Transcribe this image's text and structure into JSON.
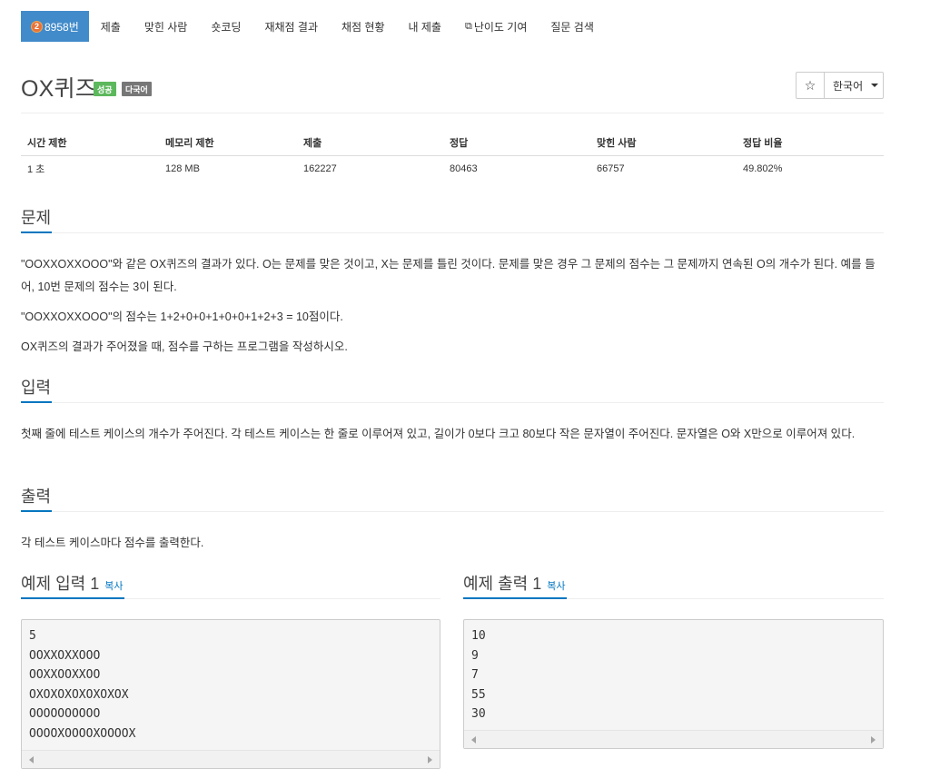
{
  "nav": {
    "problem_badge": "2",
    "problem_number": "8958번",
    "items": [
      "제출",
      "맞힌 사람",
      "숏코딩",
      "재채점 결과",
      "채점 현황",
      "내 제출",
      "난이도 기여",
      "질문 검색"
    ]
  },
  "problem": {
    "title": "OX퀴즈",
    "labels": [
      "성공",
      "다국어"
    ],
    "star_icon": "star-icon",
    "language": "한국어"
  },
  "info_table": {
    "headers": [
      "시간 제한",
      "메모리 제한",
      "제출",
      "정답",
      "맞힌 사람",
      "정답 비율"
    ],
    "values": [
      "1 초",
      "128 MB",
      "162227",
      "80463",
      "66757",
      "49.802%"
    ]
  },
  "sections": {
    "problem_title": "문제",
    "problem_text": [
      "\"OOXXOXXOOO\"와 같은 OX퀴즈의 결과가 있다. O는 문제를 맞은 것이고, X는 문제를 틀린 것이다. 문제를 맞은 경우 그 문제의 점수는 그 문제까지 연속된 O의 개수가 된다. 예를 들어, 10번 문제의 점수는 3이 된다.",
      "\"OOXXOXXOOO\"의 점수는 1+2+0+0+1+0+0+1+2+3 = 10점이다.",
      "OX퀴즈의 결과가 주어졌을 때, 점수를 구하는 프로그램을 작성하시오."
    ],
    "input_title": "입력",
    "input_text": "첫째 줄에 테스트 케이스의 개수가 주어진다. 각 테스트 케이스는 한 줄로 이루어져 있고, 길이가 0보다 크고 80보다 작은 문자열이 주어진다. 문자열은 O와 X만으로 이루어져 있다.",
    "output_title": "출력",
    "output_text": "각 테스트 케이스마다 점수를 출력한다."
  },
  "samples": {
    "input_title": "예제 입력 1",
    "output_title": "예제 출력 1",
    "copy_label": "복사",
    "input": "5\nOOXXOXXOOO\nOOXXOOXXOO\nOXOXOXOXOXOXOX\nOOOOOOOOOO\nOOOOXOOOOXOOOOX",
    "output": "10\n9\n7\n55\n30"
  },
  "colors": {
    "nav_active": "#428bca",
    "label_success": "#5cb85c",
    "label_multi": "#777777",
    "heading_underline": "#0076c0"
  }
}
